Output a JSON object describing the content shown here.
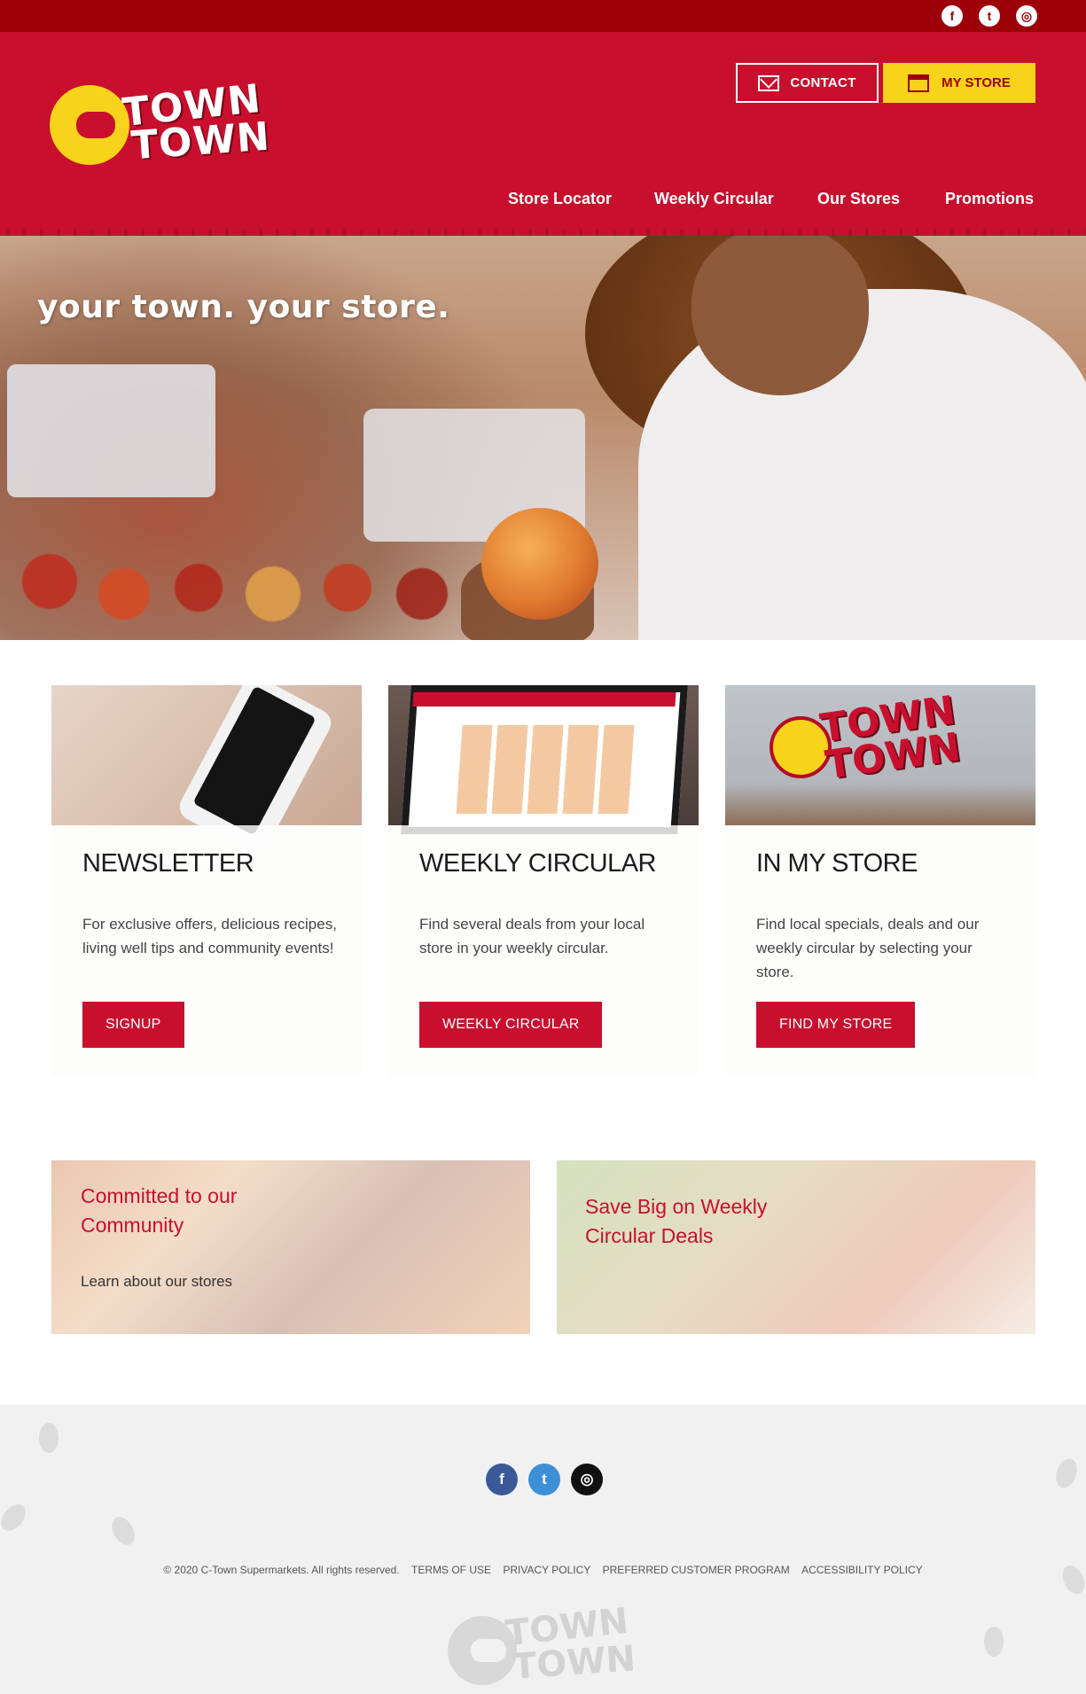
{
  "topbar": {
    "social": [
      "facebook-icon",
      "twitter-icon",
      "instagram-icon"
    ]
  },
  "header": {
    "logo_line1": "TOWN",
    "logo_line2": "TOWN",
    "contact_label": "CONTACT",
    "mystore_label": "MY STORE",
    "nav": [
      "Store Locator",
      "Weekly Circular",
      "Our Stores",
      "Promotions"
    ]
  },
  "hero": {
    "tagline": "your town. your store."
  },
  "cards": [
    {
      "title": "NEWSLETTER",
      "body": "For exclusive offers, delicious recipes, living well tips and community events!",
      "button": "SIGNUP"
    },
    {
      "title": "WEEKLY CIRCULAR",
      "body": "Find several deals from your local store in your weekly circular.",
      "button": "WEEKLY CIRCULAR"
    },
    {
      "title": "IN MY STORE",
      "body": "Find local specials, deals and our weekly circular by selecting your store.",
      "button": "FIND MY STORE"
    }
  ],
  "promos": [
    {
      "title": "Committed to our Community",
      "sub": "Learn about our stores"
    },
    {
      "title": "Save Big on Weekly Circular Deals"
    }
  ],
  "footer": {
    "copyright": "© 2020 C-Town Supermarkets. All rights reserved.",
    "links": [
      "TERMS OF USE",
      "PRIVACY POLICY",
      "PREFERRED CUSTOMER PROGRAM",
      "ACCESSIBILITY POLICY"
    ]
  },
  "colors": {
    "brand_red": "#c8102e",
    "dark_red": "#9c0008",
    "brand_yellow": "#f7d31c"
  }
}
